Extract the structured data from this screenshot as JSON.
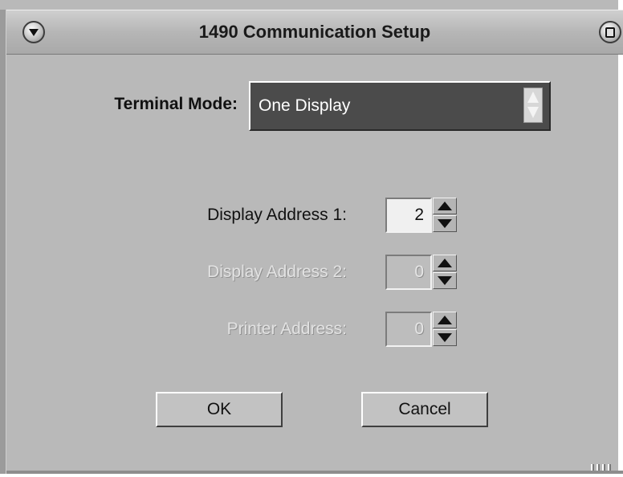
{
  "window": {
    "title": "1490 Communication Setup",
    "menu_icon": "window-menu-icon",
    "maximize_icon": "maximize-icon"
  },
  "terminal_mode": {
    "label": "Terminal Mode:",
    "value": "One Display"
  },
  "addresses": {
    "display1": {
      "label": "Display Address 1:",
      "value": "2",
      "enabled": true
    },
    "display2": {
      "label": "Display Address 2:",
      "value": "0",
      "enabled": false
    },
    "printer": {
      "label": "Printer Address:",
      "value": "0",
      "enabled": false
    }
  },
  "buttons": {
    "ok": "OK",
    "cancel": "Cancel"
  },
  "colors": {
    "background": "#b9b9b9",
    "select_background": "#4b4b4b",
    "disabled_text": "#e2e2e2"
  }
}
